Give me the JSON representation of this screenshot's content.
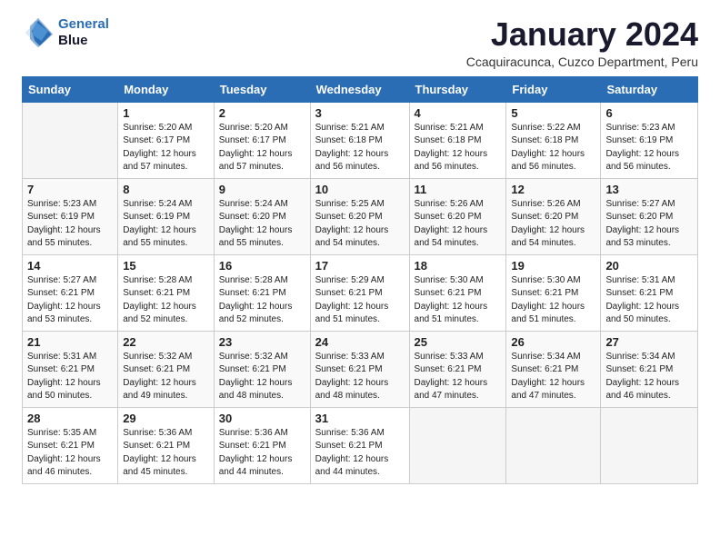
{
  "logo": {
    "line1": "General",
    "line2": "Blue"
  },
  "header": {
    "title": "January 2024",
    "subtitle": "Ccaquiracunca, Cuzco Department, Peru"
  },
  "weekdays": [
    "Sunday",
    "Monday",
    "Tuesday",
    "Wednesday",
    "Thursday",
    "Friday",
    "Saturday"
  ],
  "weeks": [
    [
      {
        "day": "",
        "sunrise": "",
        "sunset": "",
        "daylight": ""
      },
      {
        "day": "1",
        "sunrise": "Sunrise: 5:20 AM",
        "sunset": "Sunset: 6:17 PM",
        "daylight": "Daylight: 12 hours and 57 minutes."
      },
      {
        "day": "2",
        "sunrise": "Sunrise: 5:20 AM",
        "sunset": "Sunset: 6:17 PM",
        "daylight": "Daylight: 12 hours and 57 minutes."
      },
      {
        "day": "3",
        "sunrise": "Sunrise: 5:21 AM",
        "sunset": "Sunset: 6:18 PM",
        "daylight": "Daylight: 12 hours and 56 minutes."
      },
      {
        "day": "4",
        "sunrise": "Sunrise: 5:21 AM",
        "sunset": "Sunset: 6:18 PM",
        "daylight": "Daylight: 12 hours and 56 minutes."
      },
      {
        "day": "5",
        "sunrise": "Sunrise: 5:22 AM",
        "sunset": "Sunset: 6:18 PM",
        "daylight": "Daylight: 12 hours and 56 minutes."
      },
      {
        "day": "6",
        "sunrise": "Sunrise: 5:23 AM",
        "sunset": "Sunset: 6:19 PM",
        "daylight": "Daylight: 12 hours and 56 minutes."
      }
    ],
    [
      {
        "day": "7",
        "sunrise": "Sunrise: 5:23 AM",
        "sunset": "Sunset: 6:19 PM",
        "daylight": "Daylight: 12 hours and 55 minutes."
      },
      {
        "day": "8",
        "sunrise": "Sunrise: 5:24 AM",
        "sunset": "Sunset: 6:19 PM",
        "daylight": "Daylight: 12 hours and 55 minutes."
      },
      {
        "day": "9",
        "sunrise": "Sunrise: 5:24 AM",
        "sunset": "Sunset: 6:20 PM",
        "daylight": "Daylight: 12 hours and 55 minutes."
      },
      {
        "day": "10",
        "sunrise": "Sunrise: 5:25 AM",
        "sunset": "Sunset: 6:20 PM",
        "daylight": "Daylight: 12 hours and 54 minutes."
      },
      {
        "day": "11",
        "sunrise": "Sunrise: 5:26 AM",
        "sunset": "Sunset: 6:20 PM",
        "daylight": "Daylight: 12 hours and 54 minutes."
      },
      {
        "day": "12",
        "sunrise": "Sunrise: 5:26 AM",
        "sunset": "Sunset: 6:20 PM",
        "daylight": "Daylight: 12 hours and 54 minutes."
      },
      {
        "day": "13",
        "sunrise": "Sunrise: 5:27 AM",
        "sunset": "Sunset: 6:20 PM",
        "daylight": "Daylight: 12 hours and 53 minutes."
      }
    ],
    [
      {
        "day": "14",
        "sunrise": "Sunrise: 5:27 AM",
        "sunset": "Sunset: 6:21 PM",
        "daylight": "Daylight: 12 hours and 53 minutes."
      },
      {
        "day": "15",
        "sunrise": "Sunrise: 5:28 AM",
        "sunset": "Sunset: 6:21 PM",
        "daylight": "Daylight: 12 hours and 52 minutes."
      },
      {
        "day": "16",
        "sunrise": "Sunrise: 5:28 AM",
        "sunset": "Sunset: 6:21 PM",
        "daylight": "Daylight: 12 hours and 52 minutes."
      },
      {
        "day": "17",
        "sunrise": "Sunrise: 5:29 AM",
        "sunset": "Sunset: 6:21 PM",
        "daylight": "Daylight: 12 hours and 51 minutes."
      },
      {
        "day": "18",
        "sunrise": "Sunrise: 5:30 AM",
        "sunset": "Sunset: 6:21 PM",
        "daylight": "Daylight: 12 hours and 51 minutes."
      },
      {
        "day": "19",
        "sunrise": "Sunrise: 5:30 AM",
        "sunset": "Sunset: 6:21 PM",
        "daylight": "Daylight: 12 hours and 51 minutes."
      },
      {
        "day": "20",
        "sunrise": "Sunrise: 5:31 AM",
        "sunset": "Sunset: 6:21 PM",
        "daylight": "Daylight: 12 hours and 50 minutes."
      }
    ],
    [
      {
        "day": "21",
        "sunrise": "Sunrise: 5:31 AM",
        "sunset": "Sunset: 6:21 PM",
        "daylight": "Daylight: 12 hours and 50 minutes."
      },
      {
        "day": "22",
        "sunrise": "Sunrise: 5:32 AM",
        "sunset": "Sunset: 6:21 PM",
        "daylight": "Daylight: 12 hours and 49 minutes."
      },
      {
        "day": "23",
        "sunrise": "Sunrise: 5:32 AM",
        "sunset": "Sunset: 6:21 PM",
        "daylight": "Daylight: 12 hours and 48 minutes."
      },
      {
        "day": "24",
        "sunrise": "Sunrise: 5:33 AM",
        "sunset": "Sunset: 6:21 PM",
        "daylight": "Daylight: 12 hours and 48 minutes."
      },
      {
        "day": "25",
        "sunrise": "Sunrise: 5:33 AM",
        "sunset": "Sunset: 6:21 PM",
        "daylight": "Daylight: 12 hours and 47 minutes."
      },
      {
        "day": "26",
        "sunrise": "Sunrise: 5:34 AM",
        "sunset": "Sunset: 6:21 PM",
        "daylight": "Daylight: 12 hours and 47 minutes."
      },
      {
        "day": "27",
        "sunrise": "Sunrise: 5:34 AM",
        "sunset": "Sunset: 6:21 PM",
        "daylight": "Daylight: 12 hours and 46 minutes."
      }
    ],
    [
      {
        "day": "28",
        "sunrise": "Sunrise: 5:35 AM",
        "sunset": "Sunset: 6:21 PM",
        "daylight": "Daylight: 12 hours and 46 minutes."
      },
      {
        "day": "29",
        "sunrise": "Sunrise: 5:36 AM",
        "sunset": "Sunset: 6:21 PM",
        "daylight": "Daylight: 12 hours and 45 minutes."
      },
      {
        "day": "30",
        "sunrise": "Sunrise: 5:36 AM",
        "sunset": "Sunset: 6:21 PM",
        "daylight": "Daylight: 12 hours and 44 minutes."
      },
      {
        "day": "31",
        "sunrise": "Sunrise: 5:36 AM",
        "sunset": "Sunset: 6:21 PM",
        "daylight": "Daylight: 12 hours and 44 minutes."
      },
      {
        "day": "",
        "sunrise": "",
        "sunset": "",
        "daylight": ""
      },
      {
        "day": "",
        "sunrise": "",
        "sunset": "",
        "daylight": ""
      },
      {
        "day": "",
        "sunrise": "",
        "sunset": "",
        "daylight": ""
      }
    ]
  ]
}
